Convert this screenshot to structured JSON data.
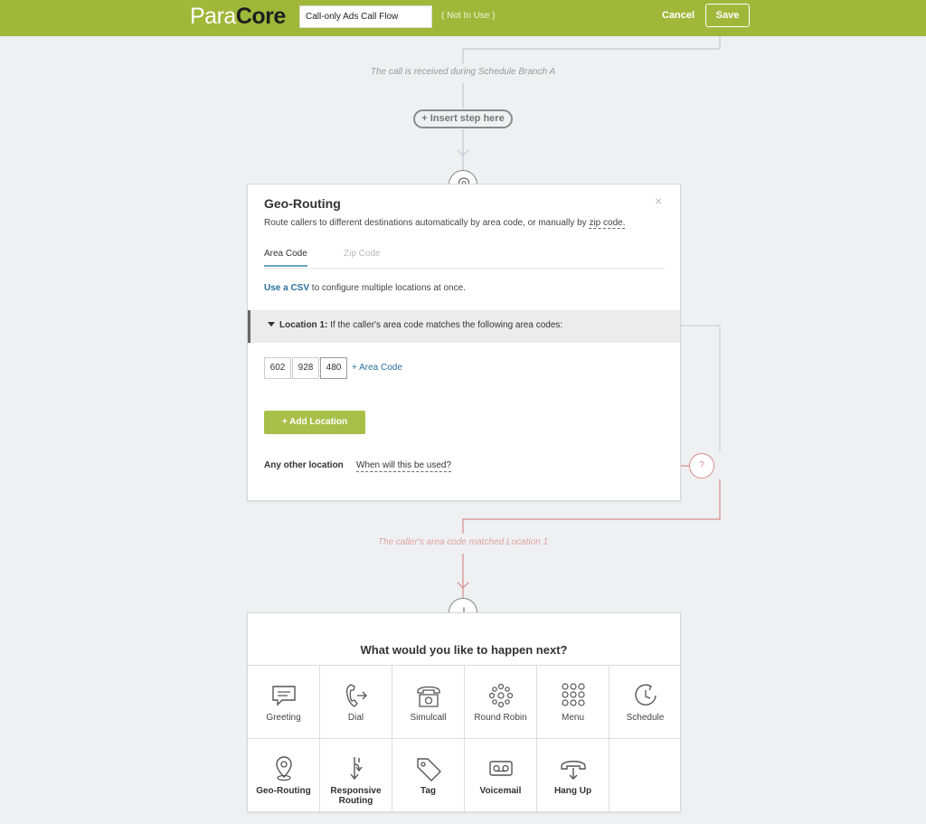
{
  "topbar": {
    "logo_part1": "Para",
    "logo_part2": "Core",
    "flow_name": "Call-only Ads Call Flow",
    "flow_status": "( Not In Use )",
    "cancel_label": "Cancel",
    "save_label": "Save"
  },
  "flow": {
    "branch_note": "The call is received during Schedule Branch A",
    "insert_step_label": "+ Insert step here",
    "match_note": "The caller's area code matched Location 1"
  },
  "geo_card": {
    "title": "Geo-Routing",
    "close": "×",
    "description": "Route callers to different destinations automatically by area code, or manually by ",
    "zip_link": "zip code.",
    "tabs": [
      {
        "label": "Area Code",
        "active": true
      },
      {
        "label": "Zip Code",
        "active": false
      }
    ],
    "csv_link": "Use a CSV",
    "csv_text": " to configure multiple locations at once.",
    "location": {
      "label": "Location 1:",
      "text": " If the caller's area code matches the following area codes:",
      "area_codes": [
        "602",
        "928",
        "480"
      ],
      "add_area_label": "+ Area Code"
    },
    "add_location_label": "+   Add Location",
    "other_location_label": "Any other location",
    "when_used_label": "When will this be used?",
    "question_mark": "?"
  },
  "next_card": {
    "title": "What would you like to happen next?",
    "options": [
      {
        "label": "Greeting",
        "icon": "greeting-icon"
      },
      {
        "label": "Dial",
        "icon": "dial-icon"
      },
      {
        "label": "Simulcall",
        "icon": "simulcall-icon"
      },
      {
        "label": "Round Robin",
        "icon": "round-robin-icon"
      },
      {
        "label": "Menu",
        "icon": "menu-icon"
      },
      {
        "label": "Schedule",
        "icon": "schedule-icon"
      },
      {
        "label": "Geo-Routing",
        "icon": "geo-routing-icon"
      },
      {
        "label": "Responsive Routing",
        "icon": "responsive-routing-icon"
      },
      {
        "label": "Tag",
        "icon": "tag-icon"
      },
      {
        "label": "Voicemail",
        "icon": "voicemail-icon"
      },
      {
        "label": "Hang Up",
        "icon": "hang-up-icon"
      }
    ]
  },
  "colors": {
    "brand_green": "#9fb83a",
    "button_green": "#a8c04a",
    "link_blue": "#2a6f9e",
    "branch_pink": "#d98b8b"
  }
}
